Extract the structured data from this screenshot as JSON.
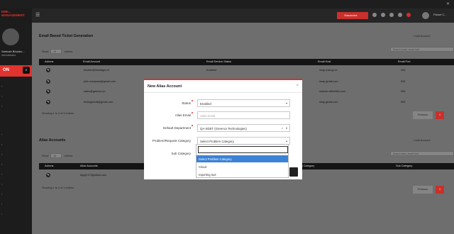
{
  "window": {
    "close": "✕"
  },
  "sidebar": {
    "logo": "DMF...\nMANAGEMENT",
    "user_name": "Santosh Bhushu...",
    "user_role": "Administrator",
    "search_label": "ON",
    "nav_items": [
      "",
      "",
      "",
      "",
      "",
      "",
      "",
      "",
      "",
      "",
      "",
      ""
    ]
  },
  "topbar": {
    "action_label": "Ghanashree",
    "user_name": "Planet C..."
  },
  "section1": {
    "title": "Email Based Ticket Generation",
    "add_button": "+ Add Account",
    "show_label": "Show",
    "entries_value": "10",
    "entries_label": "entries",
    "search_placeholder": "Search email, email host",
    "columns": [
      "Actions",
      "Email Account",
      "Email Service Status",
      "Email Host",
      "Email Port"
    ],
    "rows": [
      [
        "ticketer@infoaligns.in",
        "Enabled",
        "imap.mail.go.in",
        "993"
      ],
      [
        "john.mariposa@gmail.com",
        "",
        "imap.gmail.com",
        "993"
      ],
      [
        "sales@greenco.in",
        "",
        "outlook.office365.com",
        "993"
      ],
      [
        "testingemail@gmail.com",
        "",
        "imap.gmail.com",
        "993"
      ]
    ],
    "footer": "Showing 1 to 4 of 4 entries",
    "prev": "Previous",
    "page": "1"
  },
  "section2": {
    "title": "Alias Accounts",
    "add_button": "+ Add Account",
    "show_label": "Show",
    "entries_value": "10",
    "entries_label": "entries",
    "search_placeholder": "Search alias, email host",
    "columns": [
      "Actions",
      "Alias Accounts",
      "",
      "Sub Category",
      "Sub Category"
    ],
    "rows": [
      [
        "hppg+27@yahoo.com",
        "",
        "",
        ""
      ]
    ],
    "footer": "Showing 1 to 1 of 1 entries",
    "prev": "Previous",
    "page": "1"
  },
  "modal": {
    "title": "New Alias Account",
    "close": "×",
    "status_label": "Status",
    "status_value": "Enabled",
    "alias_label": "Alias Email",
    "alias_placeholder": "Alias Email",
    "dept_label": "Default Department",
    "dept_value": "QA-SDET (Greenco Technologies)",
    "problem_label": "Problem/Request Category",
    "problem_value": "Select Problem Category",
    "subcat_label": "Sub Category",
    "dropdown_options": [
      "Select Problem Category",
      "Cloud",
      "reporting tool"
    ]
  }
}
